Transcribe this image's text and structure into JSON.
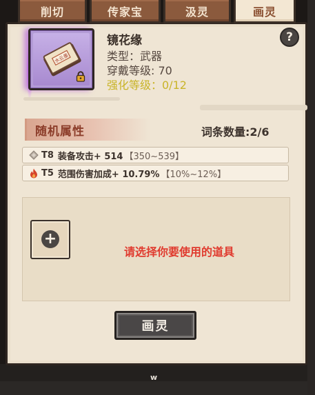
{
  "tabs": [
    {
      "label": "削切"
    },
    {
      "label": "传家宝"
    },
    {
      "label": "汲灵"
    },
    {
      "label": "画灵"
    }
  ],
  "active_tab": "画灵",
  "item": {
    "book_label": "水云墨",
    "name": "镜花缘",
    "type_line": "类型：武器",
    "level_line": "穿戴等级: 70",
    "enhance_line": "强化等级：0/12",
    "locked": true
  },
  "help": {
    "glyph": "?"
  },
  "attributes": {
    "title": "随机属性",
    "count_label": "词条数量:2/6",
    "affixes": [
      {
        "icon": "diamond-icon",
        "tier": "T8",
        "text": "装备攻击+ 514",
        "range": "【350~539】"
      },
      {
        "icon": "fire-icon",
        "tier": "T5",
        "text": "范围伤害加成+ 10.79%",
        "range": "【10%~12%】"
      }
    ]
  },
  "slot": {
    "plus": "+",
    "hint": "请选择你要使用的道具"
  },
  "action_button": {
    "label": "画灵"
  },
  "footer": {
    "mark": "w"
  },
  "colors": {
    "panel": "#efe5d4",
    "tab": "#8b5a3d",
    "tab_active": "#f3e7d3",
    "hint": "#e03a2e",
    "enhance": "#c9b428",
    "attr_title": "#8c3d2a",
    "item_bg": "#b39bd6"
  }
}
